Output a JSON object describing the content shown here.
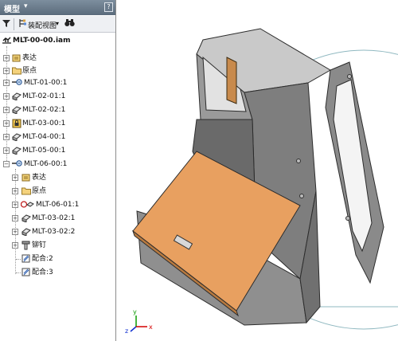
{
  "panel": {
    "title": "模型",
    "help": "?",
    "toolbar": {
      "filter_icon": "filter-icon",
      "view_icon": "assembly-view-icon",
      "view_label": "装配视图",
      "find_icon": "binoculars-icon"
    }
  },
  "tree": {
    "items": [
      {
        "label": "MLT-00-00.iam",
        "icon": "assembly-icon"
      },
      {
        "label": "表达",
        "icon": "representations-icon"
      },
      {
        "label": "原点",
        "icon": "folder-icon"
      },
      {
        "label": "MLT-01-00:1",
        "icon": "subassembly-icon"
      },
      {
        "label": "MLT-02-01:1",
        "icon": "part-icon"
      },
      {
        "label": "MLT-02-02:1",
        "icon": "part-icon"
      },
      {
        "label": "MLT-03-00:1",
        "icon": "locked-assembly-icon"
      },
      {
        "label": "MLT-04-00:1",
        "icon": "part-icon"
      },
      {
        "label": "MLT-05-00:1",
        "icon": "part-icon"
      },
      {
        "label": "MLT-06-00:1",
        "icon": "subassembly-icon"
      },
      {
        "label": "表达",
        "icon": "representations-icon"
      },
      {
        "label": "原点",
        "icon": "folder-icon"
      },
      {
        "label": "MLT-06-01:1",
        "icon": "flexible-part-icon"
      },
      {
        "label": "MLT-03-02:1",
        "icon": "part-icon"
      },
      {
        "label": "MLT-03-02:2",
        "icon": "part-icon"
      },
      {
        "label": "铆钉",
        "icon": "fastener-icon"
      },
      {
        "label": "配合:2",
        "icon": "mate-constraint-icon"
      },
      {
        "label": "配合:3",
        "icon": "mate-constraint-icon"
      }
    ]
  },
  "viewport": {
    "triad_axes": [
      "z",
      "y",
      "x"
    ],
    "colors": {
      "hinged_cover": "#e8a060",
      "enclosure_body": "#7e7e7e",
      "axis_x": "#d40000",
      "axis_y": "#0a9a00",
      "axis_z": "#1030d0",
      "guide_circle": "#8fb8c0"
    }
  }
}
